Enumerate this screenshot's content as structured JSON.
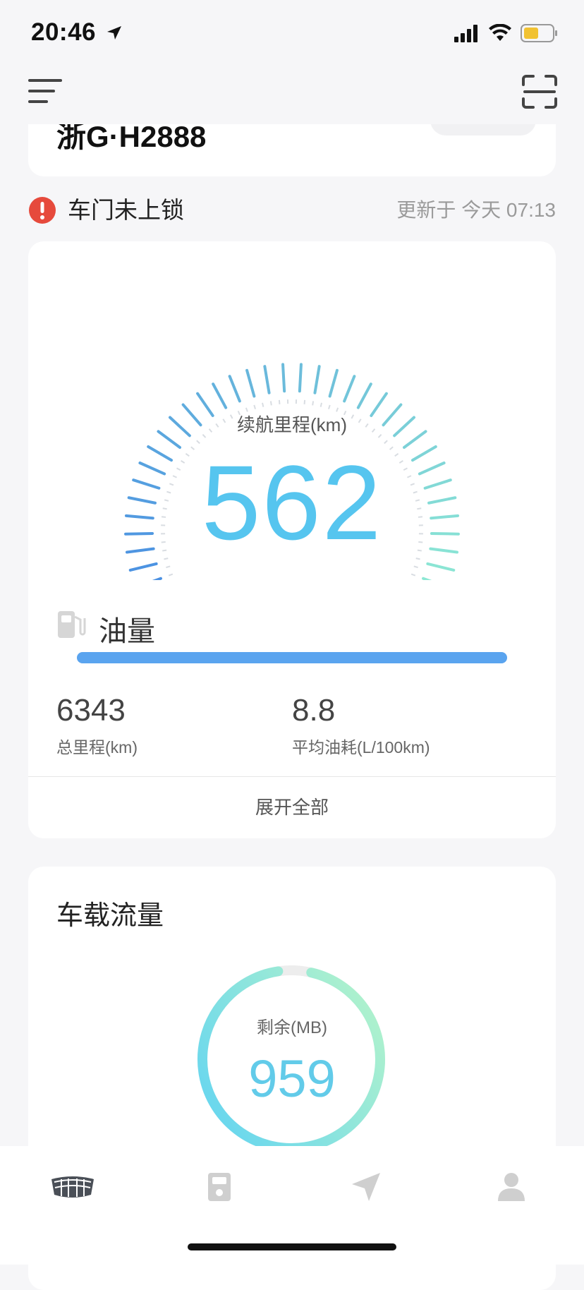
{
  "status_bar": {
    "time": "20:46"
  },
  "top_card": {
    "partial_text": "浙G·H2888"
  },
  "alert": {
    "text": "车门未上锁",
    "updated": "更新于 今天 07:13"
  },
  "range": {
    "label": "续航里程(km)",
    "value": "562"
  },
  "fuel": {
    "label": "油量",
    "level": 1.0
  },
  "stats": [
    {
      "value": "6343",
      "label": "总里程(km)"
    },
    {
      "value": "8.8",
      "label": "平均油耗(L/100km)"
    }
  ],
  "expand_label": "展开全部",
  "data_card": {
    "title": "车载流量",
    "ring_label": "剩余(MB)",
    "ring_value": "959",
    "remaining_fraction": 0.94
  },
  "tabbar": {
    "items": [
      {
        "icon": "car-brand-icon",
        "active": true
      },
      {
        "icon": "fuel-pump-icon",
        "active": false
      },
      {
        "icon": "navigation-arrow-icon",
        "active": false
      },
      {
        "icon": "profile-icon",
        "active": false
      }
    ]
  },
  "colors": {
    "accent": "#56c5ef",
    "fuel_bar": "#5aa4ef",
    "alert_red": "#e64a3c",
    "gauge_start": "#4a90e2",
    "gauge_end": "#8de8d4",
    "ring_start": "#5fd3f3",
    "ring_end": "#b8f5c8"
  }
}
